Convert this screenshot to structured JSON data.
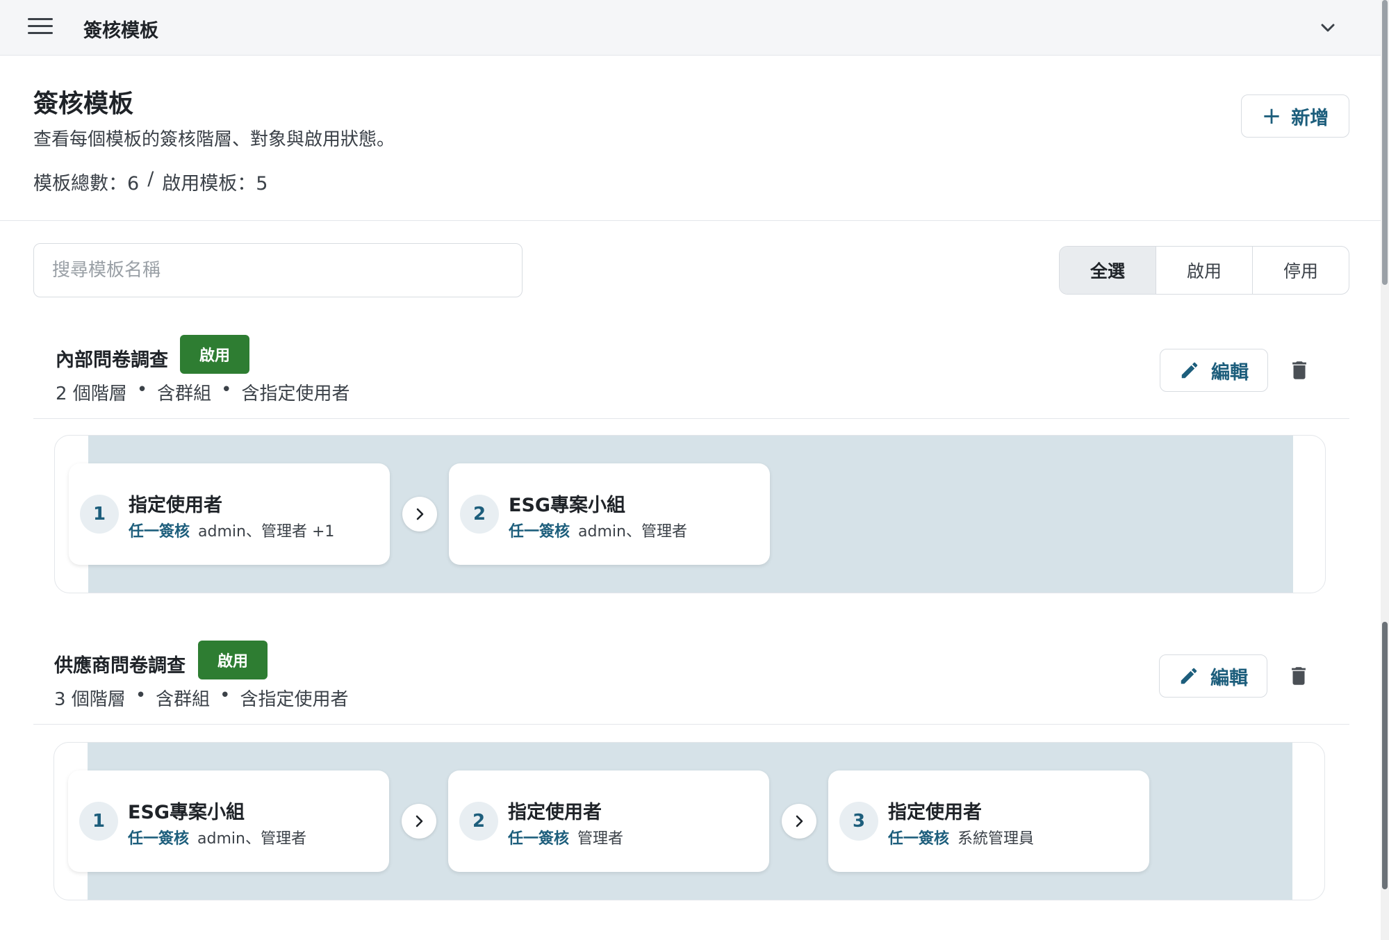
{
  "topbar": {
    "title": "簽核模板"
  },
  "header": {
    "title": "簽核模板",
    "subtitle": "查看每個模板的簽核階層、對象與啟用狀態。",
    "stats_total": "模板總數：6",
    "stats_sep": "/",
    "stats_active": "啟用模板：5",
    "add_label": "新增",
    "add_plus": "+"
  },
  "search": {
    "placeholder": "搜尋模板名稱"
  },
  "filter": {
    "options": [
      "全選",
      "啟用",
      "停用"
    ],
    "selected": "全選"
  },
  "templates": [
    {
      "name": "內部問卷調查",
      "status": "啟用",
      "meta": [
        "2 個階層",
        "•",
        "含群組",
        "•",
        "含指定使用者"
      ],
      "edit_label": "編輯",
      "steps": [
        {
          "num": "1",
          "title": "指定使用者",
          "rule": "任一簽核",
          "members": "admin、管理者 +1"
        },
        {
          "num": "2",
          "title": "ESG專案小組",
          "rule": "任一簽核",
          "members": "admin、管理者"
        }
      ]
    },
    {
      "name": "供應商問卷調查",
      "status": "啟用",
      "meta": [
        "3 個階層",
        "•",
        "含群組",
        "•",
        "含指定使用者"
      ],
      "edit_label": "編輯",
      "steps": [
        {
          "num": "1",
          "title": "ESG專案小組",
          "rule": "任一簽核",
          "members": "admin、管理者"
        },
        {
          "num": "2",
          "title": "指定使用者",
          "rule": "任一簽核",
          "members": "管理者"
        },
        {
          "num": "3",
          "title": "指定使用者",
          "rule": "任一簽核",
          "members": "系統管理員"
        }
      ]
    }
  ],
  "colors": {
    "accent": "#1d5e7c",
    "badge_green": "#2e7d32",
    "flow_bg": "#d6e2e8"
  },
  "icons": [
    "menu-icon",
    "chevron-down-icon",
    "plus-icon",
    "pencil-icon",
    "trash-icon",
    "chevron-right-icon"
  ]
}
